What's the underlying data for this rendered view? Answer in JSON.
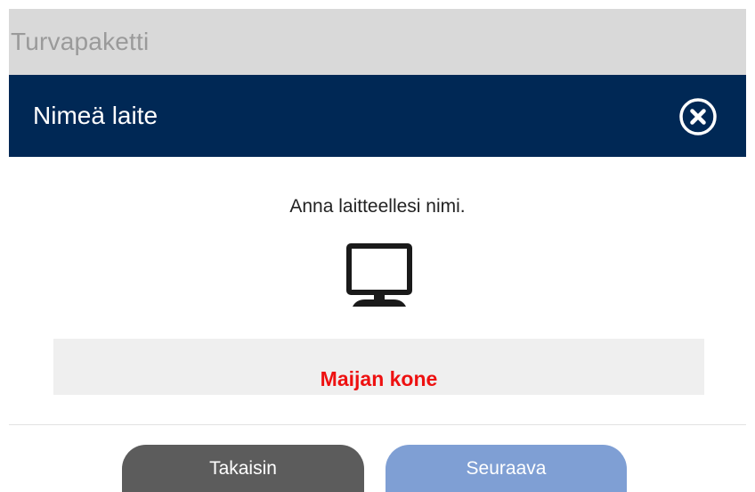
{
  "app": {
    "title": "Turvapaketti"
  },
  "dialog": {
    "title": "Nimeä laite",
    "close_icon": "close-circle-icon",
    "prompt": "Anna laitteellesi nimi.",
    "device_icon": "monitor-icon",
    "device_name_value": "Maijan kone"
  },
  "buttons": {
    "back_label": "Takaisin",
    "next_label": "Seuraava"
  },
  "colors": {
    "header_bg": "#d9d9d9",
    "titlebar_bg": "#002855",
    "device_name_text": "#ee1111",
    "back_button": "#5c5c5c",
    "next_button": "#7f9fd4"
  }
}
